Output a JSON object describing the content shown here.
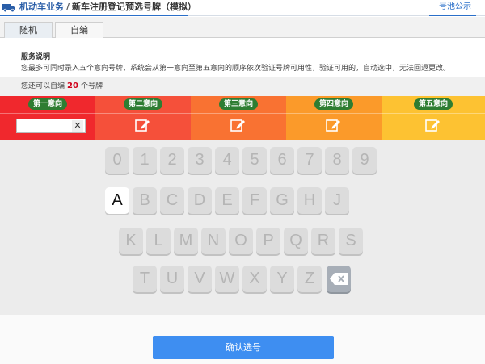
{
  "header": {
    "icon": "truck-icon",
    "section": "机动车业务",
    "separator": "/",
    "title": "新车注册登记预选号牌（模拟）",
    "pool_link": "号池公示",
    "accent": "#2a6fc9"
  },
  "tabs": [
    {
      "label": "随机"
    },
    {
      "label": "自编"
    }
  ],
  "description": {
    "title": "服务说明",
    "text": "您最多可同时录入五个意向号牌，系统会从第一意向至第五意向的顺序依次验证号牌可用性，验证可用的，自动选中，无法回退更改。"
  },
  "remaining": {
    "prefix": "您还可以自编",
    "count": "20",
    "suffix": "个号牌"
  },
  "choices": [
    {
      "label": "第一意向",
      "color": "#f0282d",
      "active": true,
      "value": ""
    },
    {
      "label": "第二意向",
      "color": "#f5503a"
    },
    {
      "label": "第三意向",
      "color": "#f97232"
    },
    {
      "label": "第四意向",
      "color": "#fb9a2a"
    },
    {
      "label": "第五意向",
      "color": "#fdc232"
    }
  ],
  "keyboard": {
    "rows": [
      [
        "0",
        "1",
        "2",
        "3",
        "4",
        "5",
        "6",
        "7",
        "8",
        "9"
      ],
      [
        "A",
        "B",
        "C",
        "D",
        "E",
        "F",
        "G",
        "H",
        "J"
      ],
      [
        "K",
        "L",
        "M",
        "N",
        "O",
        "P",
        "Q",
        "R",
        "S"
      ],
      [
        "T",
        "U",
        "V",
        "W",
        "X",
        "Y",
        "Z"
      ]
    ],
    "active_key": "A",
    "delete_icon": "backspace-icon"
  },
  "footer": {
    "confirm_label": "确认选号",
    "confirm_color": "#3e8ef1"
  }
}
